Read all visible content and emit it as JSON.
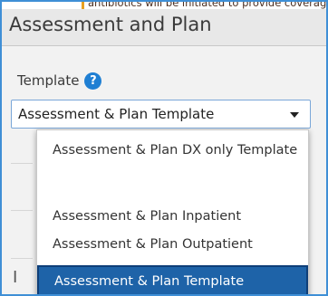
{
  "top_strip": {
    "text": "antibiotics will be initiated to provide coverage"
  },
  "section": {
    "title": "Assessment and Plan"
  },
  "template_field": {
    "label": "Template",
    "help_icon": "question-circle-icon",
    "selected_value": "Assessment & Plan Template",
    "options": [
      {
        "label": "Assessment & Plan DX only Template",
        "selected": false
      },
      {
        "label": "Assessment & Plan Inpatient",
        "selected": false
      },
      {
        "label": "Assessment & Plan Outpatient",
        "selected": false
      },
      {
        "label": "Assessment & Plan Template",
        "selected": true
      }
    ]
  },
  "colors": {
    "accent_blue": "#1f7fd3",
    "selected_option_bg": "#1e63a8",
    "frame_border": "#3f8fd6"
  }
}
